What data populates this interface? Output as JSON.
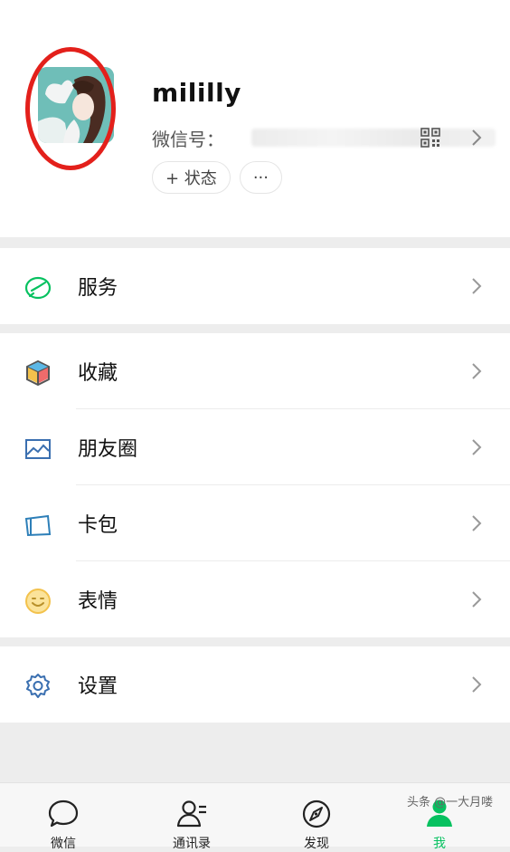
{
  "profile": {
    "name": "mililly",
    "wechat_id_label": "微信号：",
    "status_button": "+ 状态",
    "more_button": "···"
  },
  "menu": {
    "services": {
      "label": "服务",
      "icon": "services-icon",
      "color": "#07c160"
    },
    "favorites": {
      "label": "收藏",
      "icon": "favorites-cube-icon"
    },
    "moments": {
      "label": "朋友圈",
      "icon": "moments-image-icon",
      "color": "#3a6fb0"
    },
    "cards": {
      "label": "卡包",
      "icon": "wallet-card-icon",
      "color": "#2d7fb8"
    },
    "stickers": {
      "label": "表情",
      "icon": "smiley-icon",
      "color": "#f7c84a"
    },
    "settings": {
      "label": "设置",
      "icon": "gear-icon",
      "color": "#3a6fb0"
    }
  },
  "tabbar": {
    "chats": "微信",
    "contacts": "通讯录",
    "discover": "发现",
    "me": "我",
    "active_color": "#07c160"
  },
  "watermark": "头条 @一大月喽"
}
